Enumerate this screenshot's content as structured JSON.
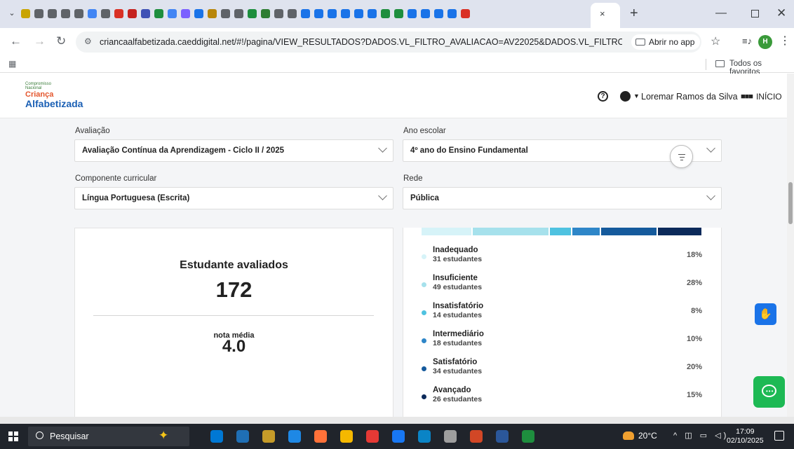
{
  "browser": {
    "url": "criancaalfabetizada.caeddigital.net/#!/pagina/VIEW_RESULTADOS?DADOS.VL_FILTRO_AVALIACAO=AV22025&DADOS.VL_FILTRO_ETAPA=ENSINO...",
    "open_in_app": "Abrir no app",
    "all_bookmarks": "Todos os favoritos",
    "tab_close": "×",
    "new_tab": "+",
    "profile_initial": "H",
    "tab_favicon_colors": [
      "#c9a400",
      "#5f6368",
      "#5f6368",
      "#5f6368",
      "#5f6368",
      "#4285f4",
      "#5f6368",
      "#d93025",
      "#c5221f",
      "#3f51b5",
      "#1e8e3e",
      "#4285f4",
      "#7b61ff",
      "#1a73e8",
      "#b8860b",
      "#5f6368",
      "#5f6368",
      "#1e8e3e",
      "#2e7d32",
      "#5f6368",
      "#5f6368",
      "#1a73e8",
      "#1a73e8",
      "#1a73e8",
      "#1a73e8",
      "#1a73e8",
      "#1a73e8",
      "#1e8e3e",
      "#1e8e3e",
      "#1a73e8",
      "#1a73e8",
      "#1a73e8",
      "#1a73e8",
      "#d93025"
    ]
  },
  "header": {
    "logo_line1": "Compromisso",
    "logo_line2": "Nacional",
    "logo_line3": "Criança",
    "logo_line4": "Alfabetizada",
    "help_symbol": "?",
    "user_name": "Loremar Ramos da Silva",
    "home_label": "INÍCIO"
  },
  "filters": {
    "avaliacao_label": "Avaliação",
    "avaliacao_value": "Avaliação Contínua da Aprendizagem - Ciclo II / 2025",
    "ano_label": "Ano escolar",
    "ano_value": "4º ano do Ensino Fundamental",
    "componente_label": "Componente curricular",
    "componente_value": "Língua Portuguesa (Escrita)",
    "rede_label": "Rede",
    "rede_value": "Pública"
  },
  "summary": {
    "title": "Estudante avaliados",
    "count": "172",
    "avg_label": "nota média",
    "avg_value": "4.0"
  },
  "levels": [
    {
      "name": "Inadequado",
      "students": "31 estudantes",
      "percent": "18%",
      "color": "#d6f3f8"
    },
    {
      "name": "Insuficiente",
      "students": "49 estudantes",
      "percent": "28%",
      "color": "#a6e1ec"
    },
    {
      "name": "Insatisfatório",
      "students": "14 estudantes",
      "percent": "8%",
      "color": "#4fc2e0"
    },
    {
      "name": "Intermediário",
      "students": "18 estudantes",
      "percent": "10%",
      "color": "#2e86c8"
    },
    {
      "name": "Satisfatório",
      "students": "34 estudantes",
      "percent": "20%",
      "color": "#155a9c"
    },
    {
      "name": "Avançado",
      "students": "26 estudantes",
      "percent": "15%",
      "color": "#0c2a5a"
    }
  ],
  "bar_segments": [
    {
      "color": "#d6f3f8",
      "fraction": 0.183
    },
    {
      "color": "#a6e1ec",
      "fraction": 0.277
    },
    {
      "color": "#4fc2e0",
      "fraction": 0.077
    },
    {
      "color": "#2e86c8",
      "fraction": 0.101
    },
    {
      "color": "#155a9c",
      "fraction": 0.204
    },
    {
      "color": "#0c2a5a",
      "fraction": 0.158
    }
  ],
  "taskbar": {
    "search_placeholder": "Pesquisar",
    "temperature": "20°C",
    "time": "17:09",
    "date": "02/10/2025",
    "app_colors": [
      "#0078d4",
      "#1f6fb5",
      "#c59b29",
      "#1e88e5",
      "#ff7139",
      "#f5b800",
      "#e53935",
      "#1877f2",
      "#0a84c6",
      "#9e9e9e",
      "#d24726",
      "#2b579a",
      "#1e8e3e"
    ]
  }
}
